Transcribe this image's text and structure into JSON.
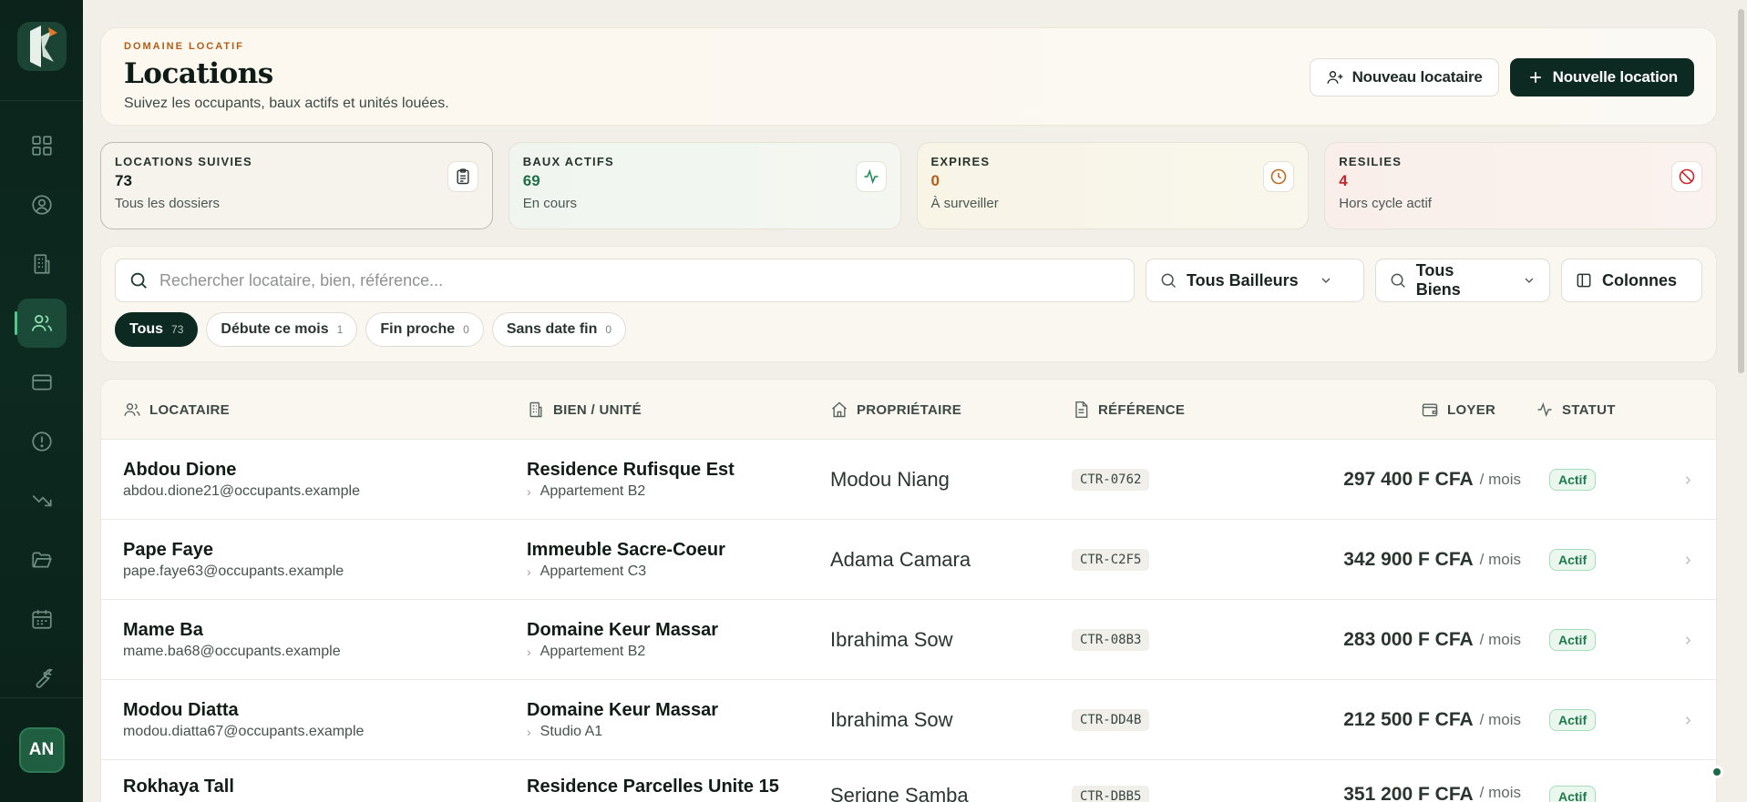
{
  "sidebar": {
    "nav": [
      "dashboard",
      "profile",
      "buildings",
      "locations",
      "payments",
      "alerts",
      "trends",
      "documents",
      "calendar",
      "tools"
    ],
    "active": "locations",
    "avatar_initials": "AN"
  },
  "header": {
    "eyebrow": "DOMAINE LOCATIF",
    "title": "Locations",
    "subtitle": "Suivez les occupants, baux actifs et unités louées.",
    "new_tenant_label": "Nouveau locataire",
    "new_rental_label": "Nouvelle location"
  },
  "stats": [
    {
      "label": "LOCATIONS SUIVIES",
      "value": "73",
      "sub": "Tous les dossiers",
      "value_color": "#111c17",
      "icon": "clipboard-icon"
    },
    {
      "label": "BAUX ACTIFS",
      "value": "69",
      "sub": "En cours",
      "value_color": "#1e6e46",
      "icon": "activity-icon"
    },
    {
      "label": "EXPIRES",
      "value": "0",
      "sub": "À surveiller",
      "value_color": "#b35d17",
      "icon": "clock-icon"
    },
    {
      "label": "RESILIES",
      "value": "4",
      "sub": "Hors cycle actif",
      "value_color": "#c9252c",
      "icon": "ban-icon"
    }
  ],
  "filters": {
    "search_placeholder": "Rechercher locataire, bien, référence...",
    "owners_select": "Tous Bailleurs",
    "assets_select": "Tous Biens",
    "columns_label": "Colonnes",
    "chips": [
      {
        "label": "Tous",
        "count": "73",
        "active": true
      },
      {
        "label": "Débute ce mois",
        "count": "1",
        "active": false
      },
      {
        "label": "Fin proche",
        "count": "0",
        "active": false
      },
      {
        "label": "Sans date fin",
        "count": "0",
        "active": false
      }
    ]
  },
  "table": {
    "columns": {
      "tenant": "LOCATAIRE",
      "asset": "BIEN / UNITÉ",
      "owner": "PROPRIÉTAIRE",
      "reference": "RÉFÉRENCE",
      "rent": "LOYER",
      "status": "STATUT"
    },
    "per_month": "/ mois",
    "rows": [
      {
        "name": "Abdou Dione",
        "email": "abdou.dione21@occupants.example",
        "asset": "Residence Rufisque Est",
        "unit": "Appartement B2",
        "owner": "Modou Niang",
        "ref": "CTR-0762",
        "rent": "297 400 F CFA",
        "status": "Actif"
      },
      {
        "name": "Pape Faye",
        "email": "pape.faye63@occupants.example",
        "asset": "Immeuble Sacre-Coeur",
        "unit": "Appartement C3",
        "owner": "Adama Camara",
        "ref": "CTR-C2F5",
        "rent": "342 900 F CFA",
        "status": "Actif"
      },
      {
        "name": "Mame Ba",
        "email": "mame.ba68@occupants.example",
        "asset": "Domaine Keur Massar",
        "unit": "Appartement B2",
        "owner": "Ibrahima Sow",
        "ref": "CTR-08B3",
        "rent": "283 000 F CFA",
        "status": "Actif"
      },
      {
        "name": "Modou Diatta",
        "email": "modou.diatta67@occupants.example",
        "asset": "Domaine Keur Massar",
        "unit": "Studio A1",
        "owner": "Ibrahima Sow",
        "ref": "CTR-DD4B",
        "rent": "212 500 F CFA",
        "status": "Actif"
      },
      {
        "name": "Rokhaya Tall",
        "email": "",
        "asset": "Residence Parcelles Unite 15",
        "unit": "",
        "owner": "Serigne Samba",
        "ref": "CTR-DBB5",
        "rent": "351 200 F CFA",
        "status": "Actif"
      }
    ]
  }
}
